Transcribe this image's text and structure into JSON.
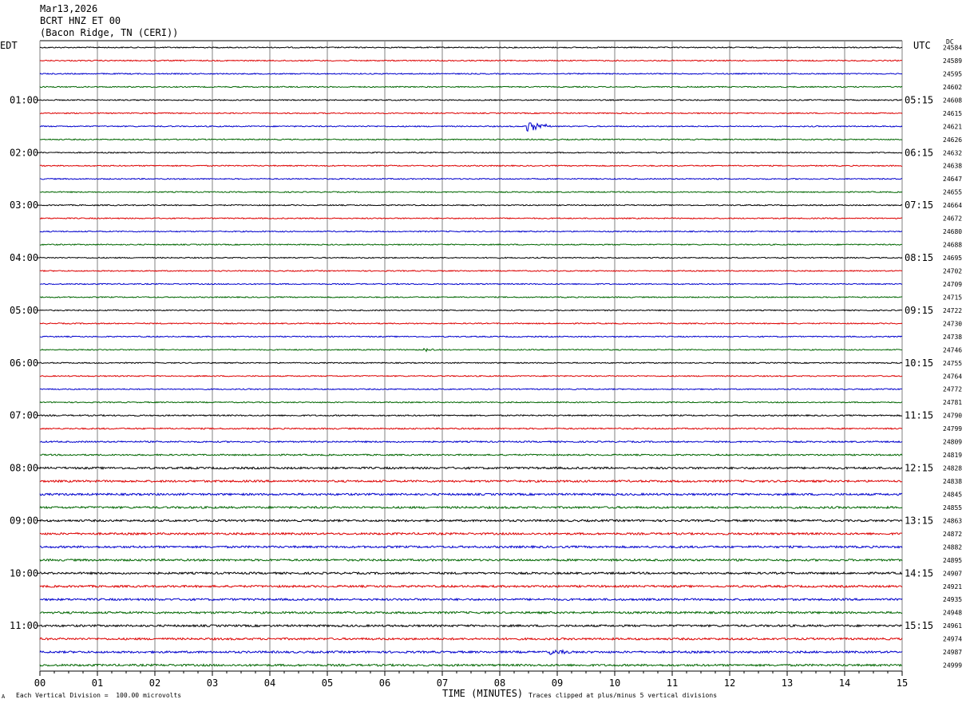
{
  "header": {
    "date": "Mar13,2026",
    "station": "BCRT HNZ ET 00",
    "location": "(Bacon Ridge, TN (CERI))"
  },
  "left_timezone": "EDT",
  "right_timezone": "UTC",
  "right_corner_label": "DC",
  "footer": {
    "scale_note": "Each Vertical Division =  100.00 microvolts",
    "axis_title": "TIME (MINUTES)",
    "clip_note": "Traces clipped at plus/minus 5 vertical divisions",
    "corner_mark": "A"
  },
  "colors": {
    "black": "#000000",
    "red": "#dd0000",
    "blue": "#0000cc",
    "green": "#006600",
    "grid": "#808080"
  },
  "chart_data": {
    "type": "line",
    "title": "BCRT HNZ ET 00",
    "xlabel": "TIME (MINUTES)",
    "xlim": [
      0,
      15
    ],
    "x_ticks": [
      "00",
      "01",
      "02",
      "03",
      "04",
      "05",
      "06",
      "07",
      "08",
      "09",
      "10",
      "11",
      "12",
      "13",
      "14",
      "15"
    ],
    "trace_colors_cycle": [
      "black",
      "red",
      "blue",
      "green"
    ],
    "left_hour_labels": [
      {
        "row": 4,
        "label": "01:00"
      },
      {
        "row": 8,
        "label": "02:00"
      },
      {
        "row": 12,
        "label": "03:00"
      },
      {
        "row": 16,
        "label": "04:00"
      },
      {
        "row": 20,
        "label": "05:00"
      },
      {
        "row": 24,
        "label": "06:00"
      },
      {
        "row": 28,
        "label": "07:00"
      },
      {
        "row": 32,
        "label": "08:00"
      },
      {
        "row": 36,
        "label": "09:00"
      },
      {
        "row": 40,
        "label": "10:00"
      },
      {
        "row": 44,
        "label": "11:00"
      }
    ],
    "right_hour_labels": [
      {
        "row": 4,
        "label": "05:15"
      },
      {
        "row": 8,
        "label": "06:15"
      },
      {
        "row": 12,
        "label": "07:15"
      },
      {
        "row": 16,
        "label": "08:15"
      },
      {
        "row": 20,
        "label": "09:15"
      },
      {
        "row": 24,
        "label": "10:15"
      },
      {
        "row": 28,
        "label": "11:15"
      },
      {
        "row": 32,
        "label": "12:15"
      },
      {
        "row": 36,
        "label": "13:15"
      },
      {
        "row": 40,
        "label": "14:15"
      },
      {
        "row": 44,
        "label": "15:15"
      }
    ],
    "dc_offsets": [
      "24584",
      "24589",
      "24595",
      "24602",
      "24608",
      "24615",
      "24621",
      "24626",
      "24632",
      "24638",
      "24647",
      "24655",
      "24664",
      "24672",
      "24680",
      "24688",
      "24695",
      "24702",
      "24709",
      "24715",
      "24722",
      "24730",
      "24738",
      "24746",
      "24755",
      "24764",
      "24772",
      "24781",
      "24790",
      "24799",
      "24809",
      "24819",
      "24828",
      "24838",
      "24845",
      "24855",
      "24863",
      "24872",
      "24882",
      "24895",
      "24907",
      "24921",
      "24935",
      "24948",
      "24961",
      "24974",
      "24987",
      "24999"
    ],
    "trace_noise_level": [
      1,
      1,
      1,
      1,
      1,
      1,
      1,
      1,
      1,
      1,
      1,
      1,
      1,
      1,
      1,
      1,
      1,
      1,
      1,
      1,
      1,
      1,
      1,
      1,
      1,
      1,
      1,
      1,
      1.2,
      1.2,
      1.3,
      1.3,
      1.8,
      1.8,
      1.8,
      1.8,
      1.8,
      1.8,
      1.8,
      1.8,
      1.8,
      1.8,
      1.8,
      1.8,
      1.8,
      1.8,
      1.8,
      1.8
    ],
    "events": [
      {
        "row": 6,
        "minute": 8.5,
        "duration_min": 0.4,
        "amplitude_divisions": 0.55
      },
      {
        "row": 23,
        "minute": 6.7,
        "duration_min": 0.3,
        "amplitude_divisions": 0.15
      },
      {
        "row": 46,
        "minute": 8.9,
        "duration_min": 0.4,
        "amplitude_divisions": 0.2
      }
    ]
  }
}
